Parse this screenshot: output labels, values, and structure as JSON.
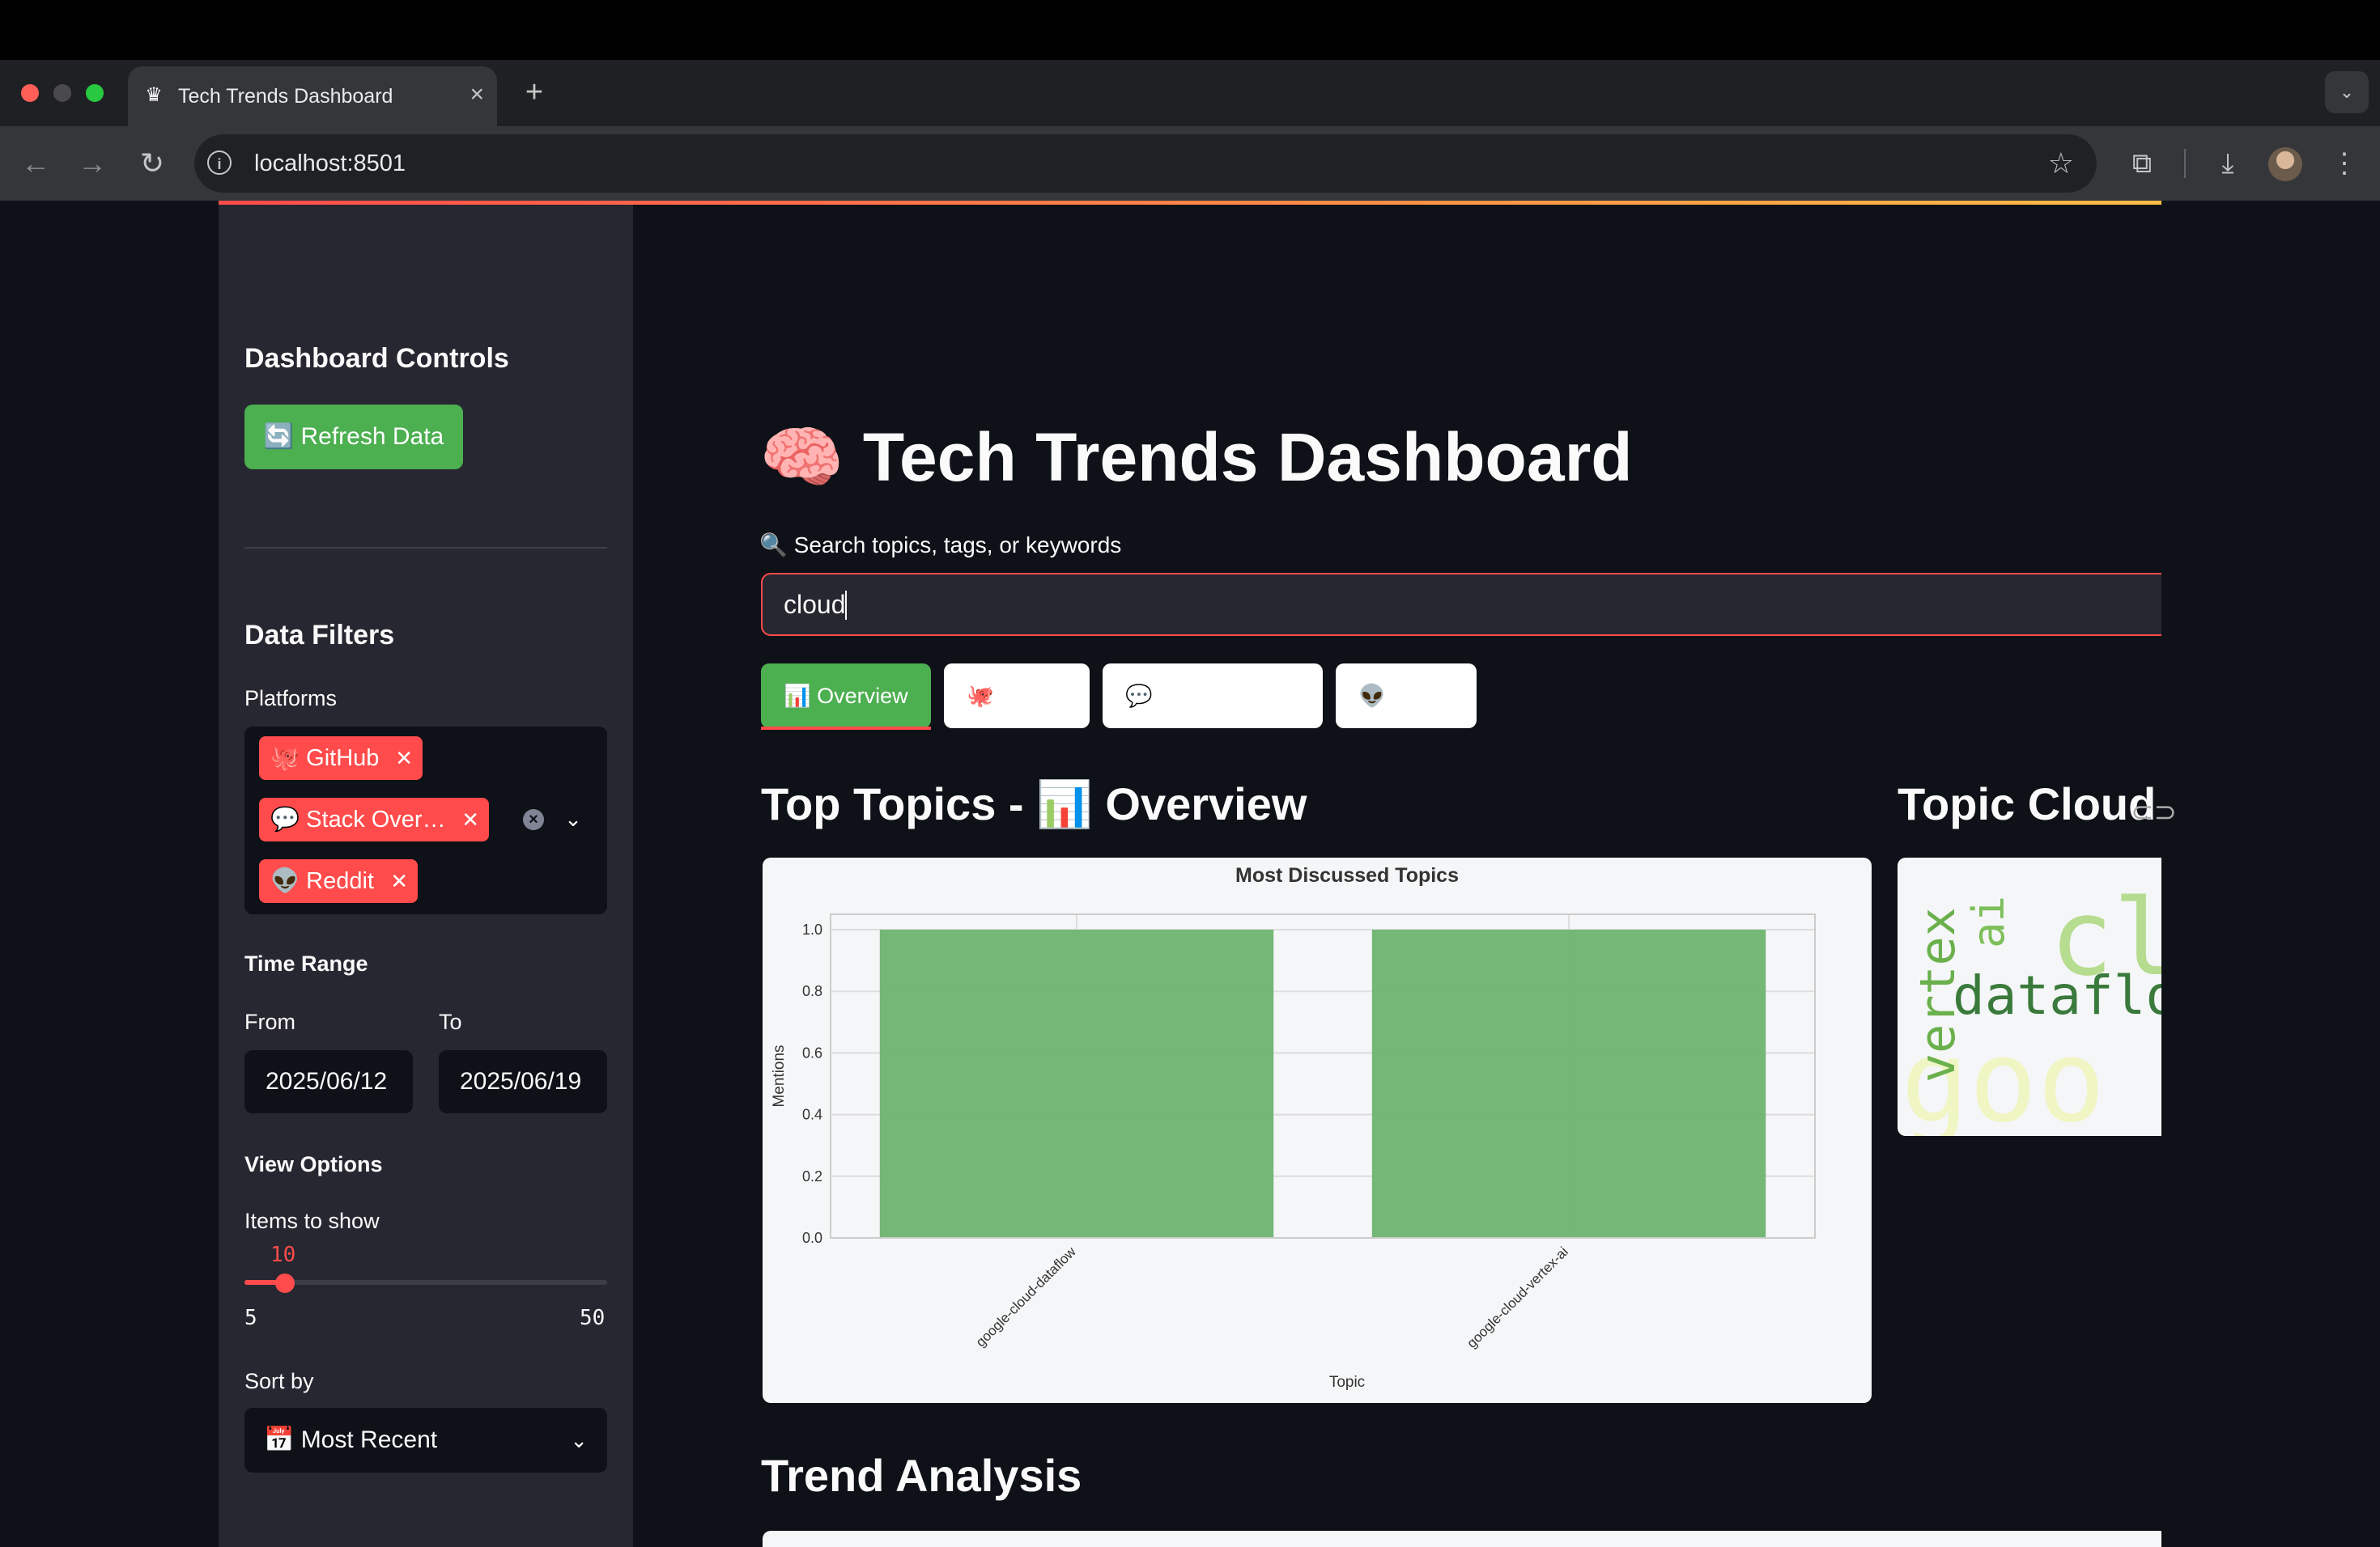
{
  "browser": {
    "tab_title": "Tech Trends Dashboard",
    "url": "localhost:8501"
  },
  "sidebar": {
    "controls_heading": "Dashboard Controls",
    "refresh_label": "🔄 Refresh Data",
    "filters_heading": "Data Filters",
    "platforms_label": "Platforms",
    "platforms": [
      "🐙 GitHub",
      "💬 Stack Over…",
      "👽 Reddit"
    ],
    "time_range_label": "Time Range",
    "from_label": "From",
    "to_label": "To",
    "from_date": "2025/06/12",
    "to_date": "2025/06/19",
    "view_options_label": "View Options",
    "items_label": "Items to show",
    "items_value": "10",
    "items_min": "5",
    "items_max": "50",
    "sort_label": "Sort by",
    "sort_value": "📅 Most Recent"
  },
  "main": {
    "title": "🧠 Tech Trends Dashboard",
    "search_label": "🔍 Search topics, tags, or keywords",
    "search_value": "cloud",
    "tabs": [
      {
        "label": "📊 Overview"
      },
      {
        "label": "🐙"
      },
      {
        "label": "💬"
      },
      {
        "label": "👽"
      }
    ],
    "top_topics_heading": "Top Topics - 📊 Overview",
    "topic_cloud_heading": "Topic Cloud",
    "trend_heading": "Trend Analysis",
    "word_cloud": [
      "cl",
      "dataflo",
      "goo",
      "vertex",
      "ai"
    ]
  },
  "colors": {
    "accent": "#ff4b4b",
    "bar": "#6db36f",
    "button_green": "#4caf50"
  },
  "chart_data": {
    "type": "bar",
    "title": "Most Discussed Topics",
    "xlabel": "Topic",
    "ylabel": "Mentions",
    "categories": [
      "google-cloud-dataflow",
      "google-cloud-vertex-ai"
    ],
    "values": [
      1.0,
      1.0
    ],
    "ylim": [
      0,
      1.05
    ],
    "yticks": [
      "0.0",
      "0.2",
      "0.4",
      "0.6",
      "0.8",
      "1.0"
    ],
    "grid": true
  }
}
